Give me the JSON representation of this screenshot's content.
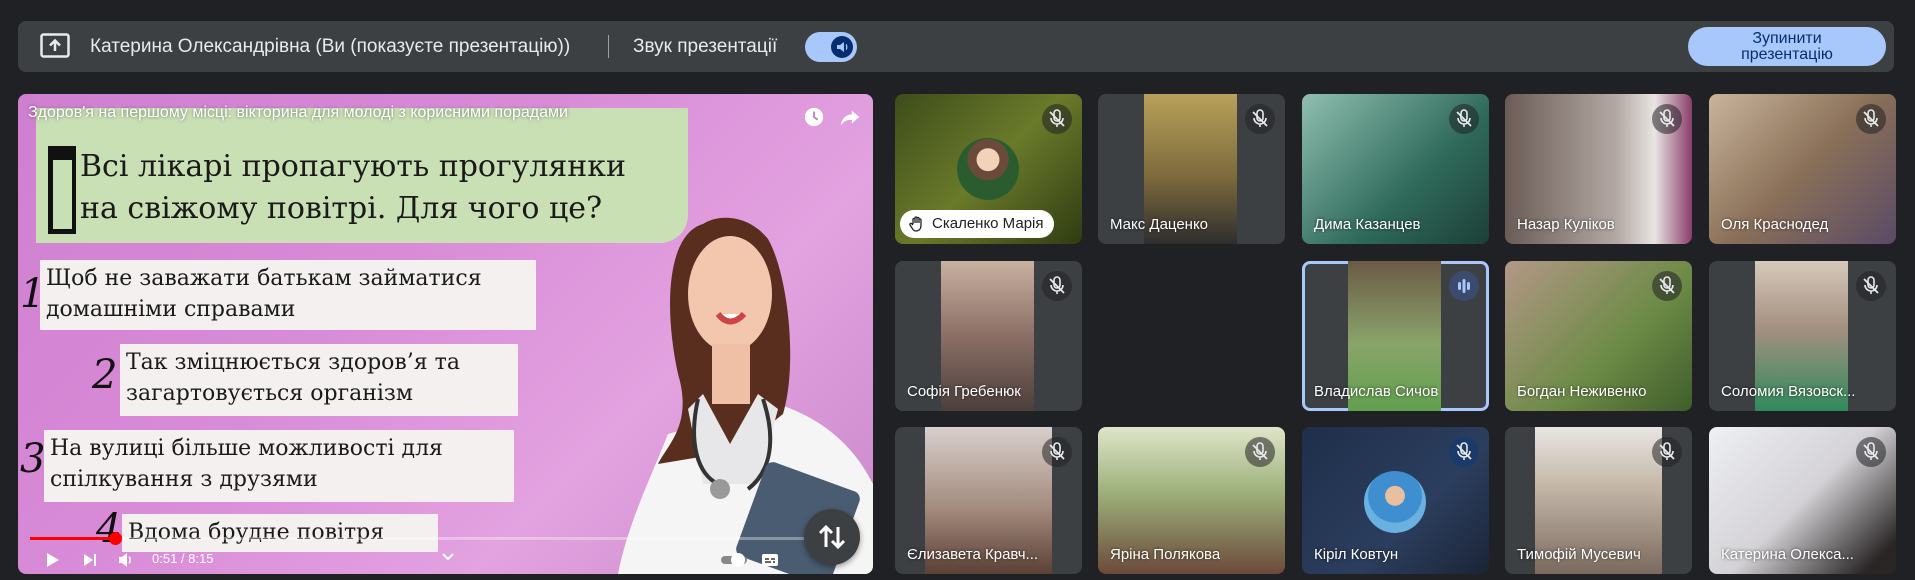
{
  "topbar": {
    "presenter": "Катерина Олександрівна (Ви (показуєте презентацію))",
    "sound_label": "Звук презентації",
    "stop_button": "Зупинити презентацію"
  },
  "video": {
    "title": "Здоров'я на першому місці: вікторина для молоді з корисними порадами",
    "question_line1": "Всі лікарі пропагують прогулянки",
    "question_line2": "на свіжому повітрі. Для чого це?",
    "answers": [
      {
        "num": "1",
        "line1": "Щоб не заважати батькам займатися",
        "line2": "домашніми справами"
      },
      {
        "num": "2",
        "line1": "Так зміцнюється здоров’я та",
        "line2": "загартовується організм"
      },
      {
        "num": "3",
        "line1": "На вулиці більше можливості для",
        "line2": "спілкування з друзями"
      },
      {
        "num": "4",
        "line1": "Вдома брудне повітря",
        "line2": ""
      }
    ],
    "time": "0:51 / 8:15",
    "progress": 0.103
  },
  "participants": [
    {
      "name": "Скаленко Марія",
      "mic": "muted",
      "bg": "#4a5b22"
    },
    {
      "name": "Макс Даценко",
      "mic": "muted",
      "bg": "#6b5a3a"
    },
    {
      "name": "Дима Казанцев",
      "mic": "muted",
      "bg": "#3b6f63"
    },
    {
      "name": "Назар Куліков",
      "mic": "muted",
      "bg": "#8a7f7a"
    },
    {
      "name": "Оля Краснодед",
      "mic": "muted",
      "bg": "#8e7c66"
    },
    {
      "name": "Софія Гребенюк",
      "mic": "muted",
      "bg": "#7a6e6b"
    },
    {
      "name": "Владислав Сичов",
      "mic": "speaking",
      "bg": "#5d7a4d"
    },
    {
      "name": "Богдан Неживенко",
      "mic": "muted",
      "bg": "#5e6b45"
    },
    {
      "name": "Соломия Вязовск...",
      "mic": "muted",
      "bg": "#4f6a55"
    },
    {
      "name": "Єлизавета Кравч...",
      "mic": "muted",
      "bg": "#8a7b74"
    },
    {
      "name": "Яріна Полякова",
      "mic": "muted",
      "bg": "#6f7a5c"
    },
    {
      "name": "Кіріл Ковтун",
      "mic": "muted",
      "bg": "#2c3e5e"
    },
    {
      "name": "Тимофій Мусевич",
      "mic": "muted",
      "bg": "#9a9894"
    },
    {
      "name": "Катерина Олекса...",
      "mic": "muted",
      "bg": "#d7d6d8"
    }
  ]
}
